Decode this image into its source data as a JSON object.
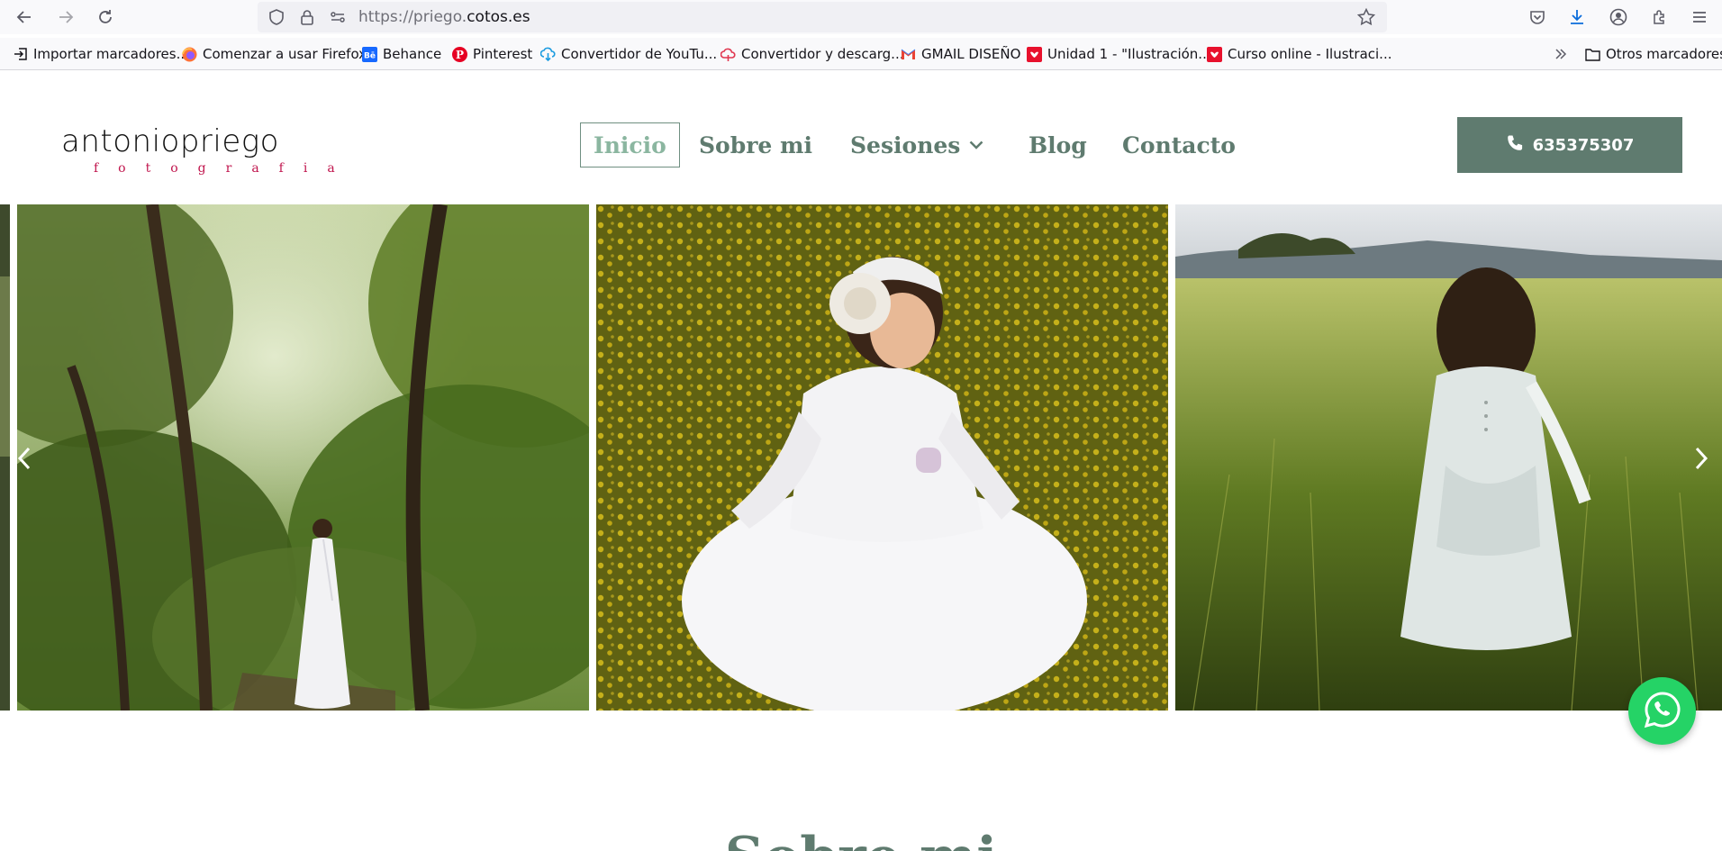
{
  "browser": {
    "url_prefix": "https://priego.",
    "url_domain": "cotos.es",
    "icons": [
      "back-icon",
      "forward-icon",
      "reload-icon",
      "shield-icon",
      "lock-icon",
      "permissions-icon",
      "star-icon",
      "pocket-icon",
      "download-icon",
      "account-icon",
      "extensions-icon",
      "menu-icon"
    ]
  },
  "bookmarks": {
    "items": [
      {
        "label": "Importar marcadores...",
        "icon": "import-icon"
      },
      {
        "label": "Comenzar a usar Firefox",
        "icon": "firefox-icon"
      },
      {
        "label": "Behance",
        "icon": "behance-icon"
      },
      {
        "label": "Pinterest",
        "icon": "pinterest-icon"
      },
      {
        "label": "Convertidor de YouTu...",
        "icon": "cloud-download-icon"
      },
      {
        "label": "Convertidor y descarg...",
        "icon": "cloud-icon"
      },
      {
        "label": "GMAIL DISEÑO",
        "icon": "gmail-icon"
      },
      {
        "label": "Unidad 1 - \"Ilustración...",
        "icon": "domestika-icon"
      },
      {
        "label": "Curso online - Ilustraci...",
        "icon": "domestika-icon"
      }
    ],
    "overflow_icon": "chevrons-right-icon",
    "other": "Otros marcadores"
  },
  "site": {
    "logo_main": "antoniopriego",
    "logo_sub": "fotografia",
    "nav": [
      {
        "label": "Inicio",
        "active": true
      },
      {
        "label": "Sobre mi"
      },
      {
        "label": "Sesiones",
        "dropdown": true
      },
      {
        "label": "Blog"
      },
      {
        "label": "Contacto"
      }
    ],
    "phone": "635375307",
    "section_title": "Sobre mi"
  },
  "colors": {
    "accent": "#5f7b6f",
    "active": "#8bb6a0",
    "logo_sub": "#c0154d",
    "whatsapp": "#25d366"
  },
  "gallery": {
    "slides": [
      "photo-girl-forest",
      "photo-girl-yellow-flowers",
      "photo-girl-wheat-field"
    ]
  }
}
